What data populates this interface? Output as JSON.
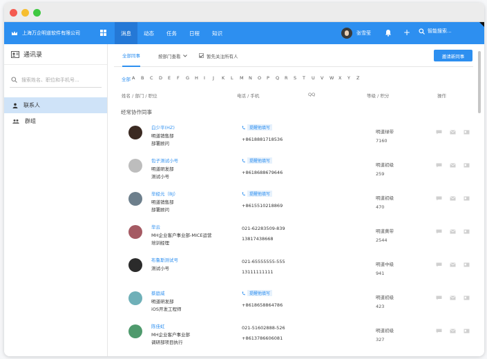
{
  "brand": {
    "name": "上海万企明道软件有限公司"
  },
  "nav": {
    "tabs": [
      {
        "label": "消息",
        "active": true
      },
      {
        "label": "动态",
        "active": false
      },
      {
        "label": "任务",
        "active": false
      },
      {
        "label": "日程",
        "active": false
      },
      {
        "label": "知识",
        "active": false
      }
    ],
    "user_name": "张雪莹",
    "search_placeholder": "智能搜索..."
  },
  "sidebar": {
    "title": "通讯录",
    "search_placeholder": "搜索姓名、职位和手机号...",
    "items": [
      {
        "label": "联系人",
        "icon": "person-icon",
        "active": true
      },
      {
        "label": "群组",
        "icon": "group-icon",
        "active": false
      }
    ]
  },
  "toolbar": {
    "tab_all": "全部同事",
    "tab_dept": "按部门查看",
    "checkbox_label": "暂先关注所有人",
    "invite_button": "邀请新同事"
  },
  "alphabet": [
    "全部",
    "A",
    "B",
    "C",
    "D",
    "E",
    "F",
    "G",
    "H",
    "I",
    "J",
    "K",
    "L",
    "M",
    "N",
    "O",
    "P",
    "Q",
    "R",
    "S",
    "T",
    "U",
    "V",
    "W",
    "X",
    "Y",
    "Z"
  ],
  "columns": {
    "name": "姓名 / 部门 / 职位",
    "phone": "电话 / 手机",
    "qq": "QQ",
    "level": "等级 / 积分",
    "ops": "操作"
  },
  "section_title": "经常协作同事",
  "remind_label": "提醒他填写",
  "contacts": [
    {
      "name": "白少平(HZ)",
      "dept": "明道销售部",
      "title": "部署顾问",
      "phone": "",
      "mobile": "+8618881718536",
      "level": "明道绿带",
      "points": "7160",
      "avatar_color": "#3b2a22"
    },
    {
      "name": "包子测试小号",
      "dept": "明道研发部",
      "title": "测试小号",
      "phone": "",
      "mobile": "+8618688679646",
      "level": "明道初级",
      "points": "259",
      "avatar_color": "#bdbdbd"
    },
    {
      "name": "毕经元（BJ）",
      "dept": "明道销售部",
      "title": "部署顾问",
      "phone": "",
      "mobile": "+8615510218869",
      "level": "明道初级",
      "points": "470",
      "avatar_color": "#6d7f8c"
    },
    {
      "name": "毕云",
      "dept": "MH企业客户事业部-MICE运营",
      "title": "培训经理",
      "phone": "021-62283509-839",
      "mobile": "13817438668",
      "level": "明道黄带",
      "points": "2544",
      "avatar_color": "#a55a63"
    },
    {
      "name": "布鲁斯测试号",
      "dept": "测试小号",
      "title": "",
      "phone": "021-65555555-555",
      "mobile": "13111111111",
      "level": "明道中级",
      "points": "941",
      "avatar_color": "#2b2b2b"
    },
    {
      "name": "蔡庭威",
      "dept": "明道研发部",
      "title": "iOS开发工程师",
      "phone": "",
      "mobile": "+8618658864786",
      "level": "明道初级",
      "points": "423",
      "avatar_color": "#6fb0b8"
    },
    {
      "name": "陈佳虹",
      "dept": "MH企业客户事业部",
      "title": "调研部项目执行",
      "phone": "021-51602888-526",
      "mobile": "+8613786606081",
      "level": "明道初级",
      "points": "327",
      "avatar_color": "#4f9a6d"
    }
  ]
}
